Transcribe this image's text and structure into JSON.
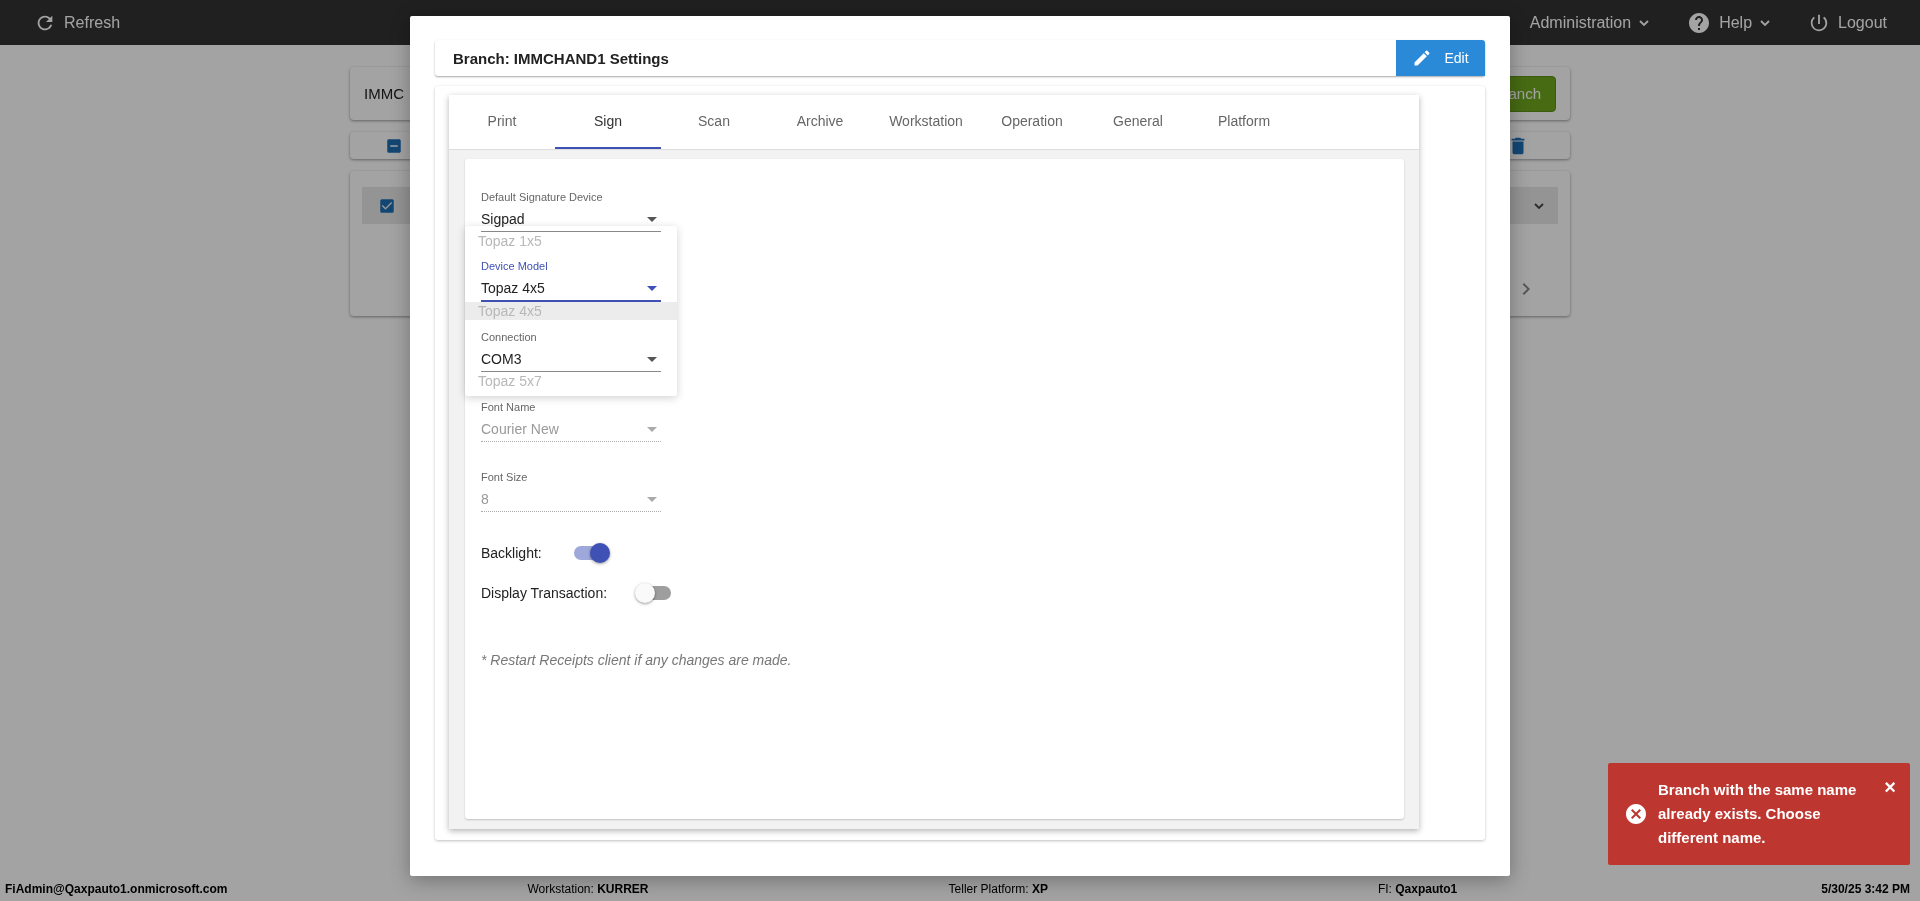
{
  "top_bar": {
    "refresh": "Refresh",
    "menus": [
      {
        "label": "Administration",
        "kind": "menu"
      },
      {
        "label": "Help",
        "kind": "help"
      }
    ],
    "logout": "Logout"
  },
  "background": {
    "search_value": "IMMC",
    "action_button": "anch",
    "header_checkbox": {
      "indeterminate": true
    },
    "rows": [
      {
        "checked": true
      }
    ]
  },
  "modal": {
    "title": "Branch: IMMCHAND1 Settings",
    "edit_button": "Edit",
    "tabs": [
      {
        "label": "Print",
        "selected": false
      },
      {
        "label": "Sign",
        "selected": true
      },
      {
        "label": "Scan",
        "selected": false
      },
      {
        "label": "Archive",
        "selected": false
      },
      {
        "label": "Workstation",
        "selected": false
      },
      {
        "label": "Operation",
        "selected": false
      },
      {
        "label": "General",
        "selected": false
      },
      {
        "label": "Platform",
        "selected": false
      }
    ],
    "fields": [
      {
        "label": "Default Signature Device",
        "value": "Sigpad",
        "disabled": false,
        "focused": false
      },
      {
        "label": "Device Model",
        "value": "Topaz 4x5",
        "disabled": false,
        "focused": true
      },
      {
        "label": "Connection",
        "value": "COM3",
        "disabled": false,
        "focused": false
      },
      {
        "label": "Font Name",
        "value": "Courier New",
        "disabled": true,
        "focused": false
      },
      {
        "label": "Font Size",
        "value": "8",
        "disabled": true,
        "focused": false
      }
    ],
    "dropdown": {
      "options": [
        {
          "label": "Topaz 1x5",
          "selected": false
        },
        {
          "label": "Topaz 4x5",
          "selected": true
        },
        {
          "label": "Topaz 5x7",
          "selected": false
        }
      ]
    },
    "toggles": [
      {
        "label": "Backlight:",
        "on": true
      },
      {
        "label": "Display Transaction:",
        "on": false
      }
    ],
    "note": "* Restart Receipts client if any changes are made."
  },
  "toast": {
    "message": "Branch with the same name already exists. Choose different name.",
    "close": "×"
  },
  "status_bar": {
    "user": "FiAdmin@Qaxpauto1.onmicrosoft.com",
    "items": [
      {
        "label": "Workstation:",
        "value": "KURRER"
      },
      {
        "label": "Teller Platform:",
        "value": "XP"
      },
      {
        "label": "FI:",
        "value": "Qaxpauto1"
      }
    ],
    "datetime": "5/30/25 3:42 PM"
  }
}
